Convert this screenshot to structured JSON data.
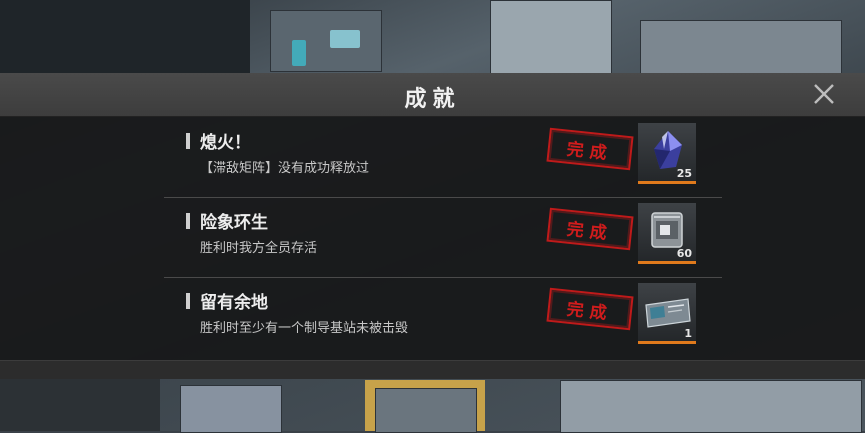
{
  "modal": {
    "title": "成就"
  },
  "achievements": [
    {
      "name": "熄火！",
      "description": "【滞敌矩阵】没有成功释放过",
      "status": "完成",
      "reward": {
        "icon": "blue-crystal-icon",
        "count": "25"
      }
    },
    {
      "name": "险象环生",
      "description": "胜利时我方全员存活",
      "status": "完成",
      "reward": {
        "icon": "metal-chest-icon",
        "count": "60"
      }
    },
    {
      "name": "留有余地",
      "description": "胜利时至少有一个制导基站未被击毁",
      "status": "完成",
      "reward": {
        "icon": "id-card-icon",
        "count": "1"
      }
    }
  ],
  "colors": {
    "stamp": "#d01c1c",
    "reward_underline": "#e07a1c",
    "header": "#444444"
  }
}
